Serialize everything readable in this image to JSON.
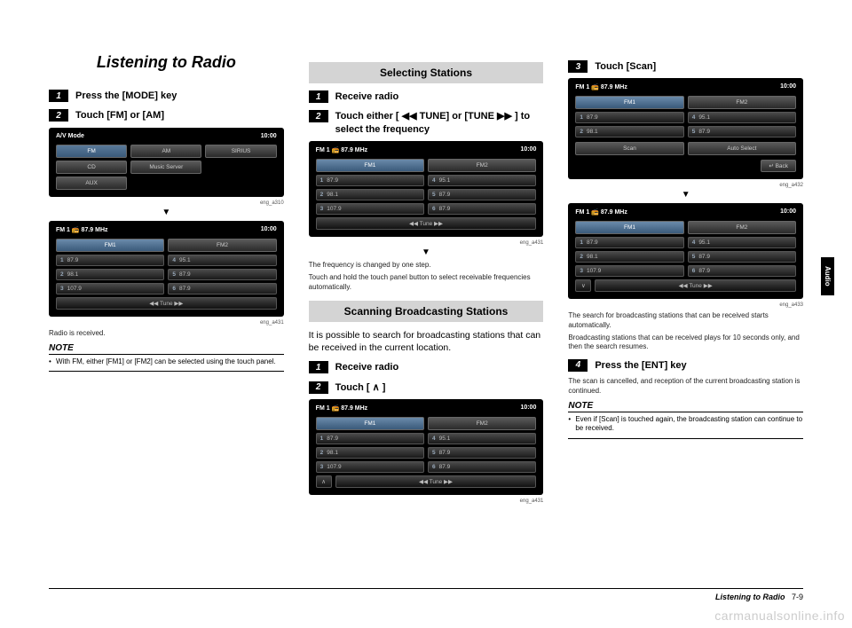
{
  "title": "Listening to Radio",
  "col1": {
    "s1": {
      "num": "1",
      "text": "Press the [MODE] key"
    },
    "s2": {
      "num": "2",
      "text": "Touch [FM] or [AM]"
    },
    "scr1": {
      "hleft": "A/V Mode",
      "hright": "10:00",
      "r1a": "FM",
      "r1b": "AM",
      "r1c": "SIRIUS",
      "r2a": "CD",
      "r2b": "Music Server",
      "r3a": "AUX",
      "label": "eng_a310"
    },
    "scr2": {
      "hleft": "FM 1   📻 87.9  MHz",
      "hright": "10:00",
      "fm1": "FM1",
      "fm2": "FM2",
      "p1n": "1",
      "p1v": "87.9",
      "p2n": "4",
      "p2v": "95.1",
      "p3n": "2",
      "p3v": "98.1",
      "p4n": "5",
      "p4v": "87.9",
      "p5n": "3",
      "p5v": "107.9",
      "p6n": "6",
      "p6v": "87.9",
      "tune": "◀◀  Tune  ▶▶",
      "label": "eng_a431"
    },
    "received": "Radio is received.",
    "note_label": "NOTE",
    "note1": "With FM, either [FM1] or [FM2] can be selected using the touch panel."
  },
  "col2": {
    "bar1": "Selecting Stations",
    "s1": {
      "num": "1",
      "text": "Receive radio"
    },
    "s2": {
      "num": "2",
      "text": "Touch either [ ◀◀ TUNE] or [TUNE ▶▶ ] to select the frequency"
    },
    "scr": {
      "hleft": "FM 1   📻 87.9  MHz",
      "hright": "10:00",
      "fm1": "FM1",
      "fm2": "FM2",
      "p1n": "1",
      "p1v": "87.9",
      "p2n": "4",
      "p2v": "95.1",
      "p3n": "2",
      "p3v": "98.1",
      "p4n": "5",
      "p4v": "87.9",
      "p5n": "3",
      "p5v": "107.9",
      "p6n": "6",
      "p6v": "87.9",
      "tune": "◀◀  Tune  ▶▶",
      "label": "eng_a431"
    },
    "desc1": "The frequency is changed by one step.",
    "desc2": "Touch and hold the touch panel button to select receivable frequencies automatically.",
    "bar2": "Scanning Broadcasting Stations",
    "intro": "It is possible to search for broadcasting stations that can be received in the current location.",
    "s3": {
      "num": "1",
      "text": "Receive radio"
    },
    "s4": {
      "num": "2",
      "text": "Touch [ ∧ ]"
    },
    "scr2": {
      "hleft": "FM 1   📻 87.9  MHz",
      "hright": "10:00",
      "fm1": "FM1",
      "fm2": "FM2",
      "p1n": "1",
      "p1v": "87.9",
      "p2n": "4",
      "p2v": "95.1",
      "p3n": "2",
      "p3v": "98.1",
      "p4n": "5",
      "p4v": "87.9",
      "p5n": "3",
      "p5v": "107.9",
      "p6n": "6",
      "p6v": "87.9",
      "tune": "◀◀  Tune  ▶▶",
      "chev": "∧",
      "label": "eng_a431"
    }
  },
  "col3": {
    "s3": {
      "num": "3",
      "text": "Touch [Scan]"
    },
    "scr1": {
      "hleft": "FM 1   📻 87.9  MHz",
      "hright": "10:00",
      "fm1": "FM1",
      "fm2": "FM2",
      "p1n": "1",
      "p1v": "87.9",
      "p2n": "4",
      "p2v": "95.1",
      "p3n": "2",
      "p3v": "98.1",
      "p4n": "5",
      "p4v": "87.9",
      "scan": "Scan",
      "auto": "Auto Select",
      "back": "↵ Back",
      "label": "eng_a432"
    },
    "scr2": {
      "hleft": "FM 1   📻 87.9  MHz",
      "hright": "10:00",
      "fm1": "FM1",
      "fm2": "FM2",
      "p1n": "1",
      "p1v": "87.9",
      "p2n": "4",
      "p2v": "95.1",
      "p3n": "2",
      "p3v": "98.1",
      "p4n": "5",
      "p4v": "87.9",
      "p5n": "3",
      "p5v": "107.9",
      "p6n": "6",
      "p6v": "87.9",
      "tune": "◀◀  Tune  ▶▶",
      "chev": "∨",
      "label": "eng_a433"
    },
    "desc1": "The search for broadcasting stations that can be received starts automatically.",
    "desc2": "Broadcasting stations that can be received plays for 10 seconds only, and then the search resumes.",
    "s4": {
      "num": "4",
      "text": "Press the [ENT] key"
    },
    "desc3": "The scan is cancelled, and reception of the current broadcasting station is continued.",
    "note_label": "NOTE",
    "note1": "Even if [Scan] is touched again, the broadcasting station can continue to be received."
  },
  "side_tab": "Audio",
  "footer": {
    "title": "Listening to Radio",
    "page": "7-9"
  },
  "watermark": "carmanualsonline.info",
  "arrow": "▼"
}
